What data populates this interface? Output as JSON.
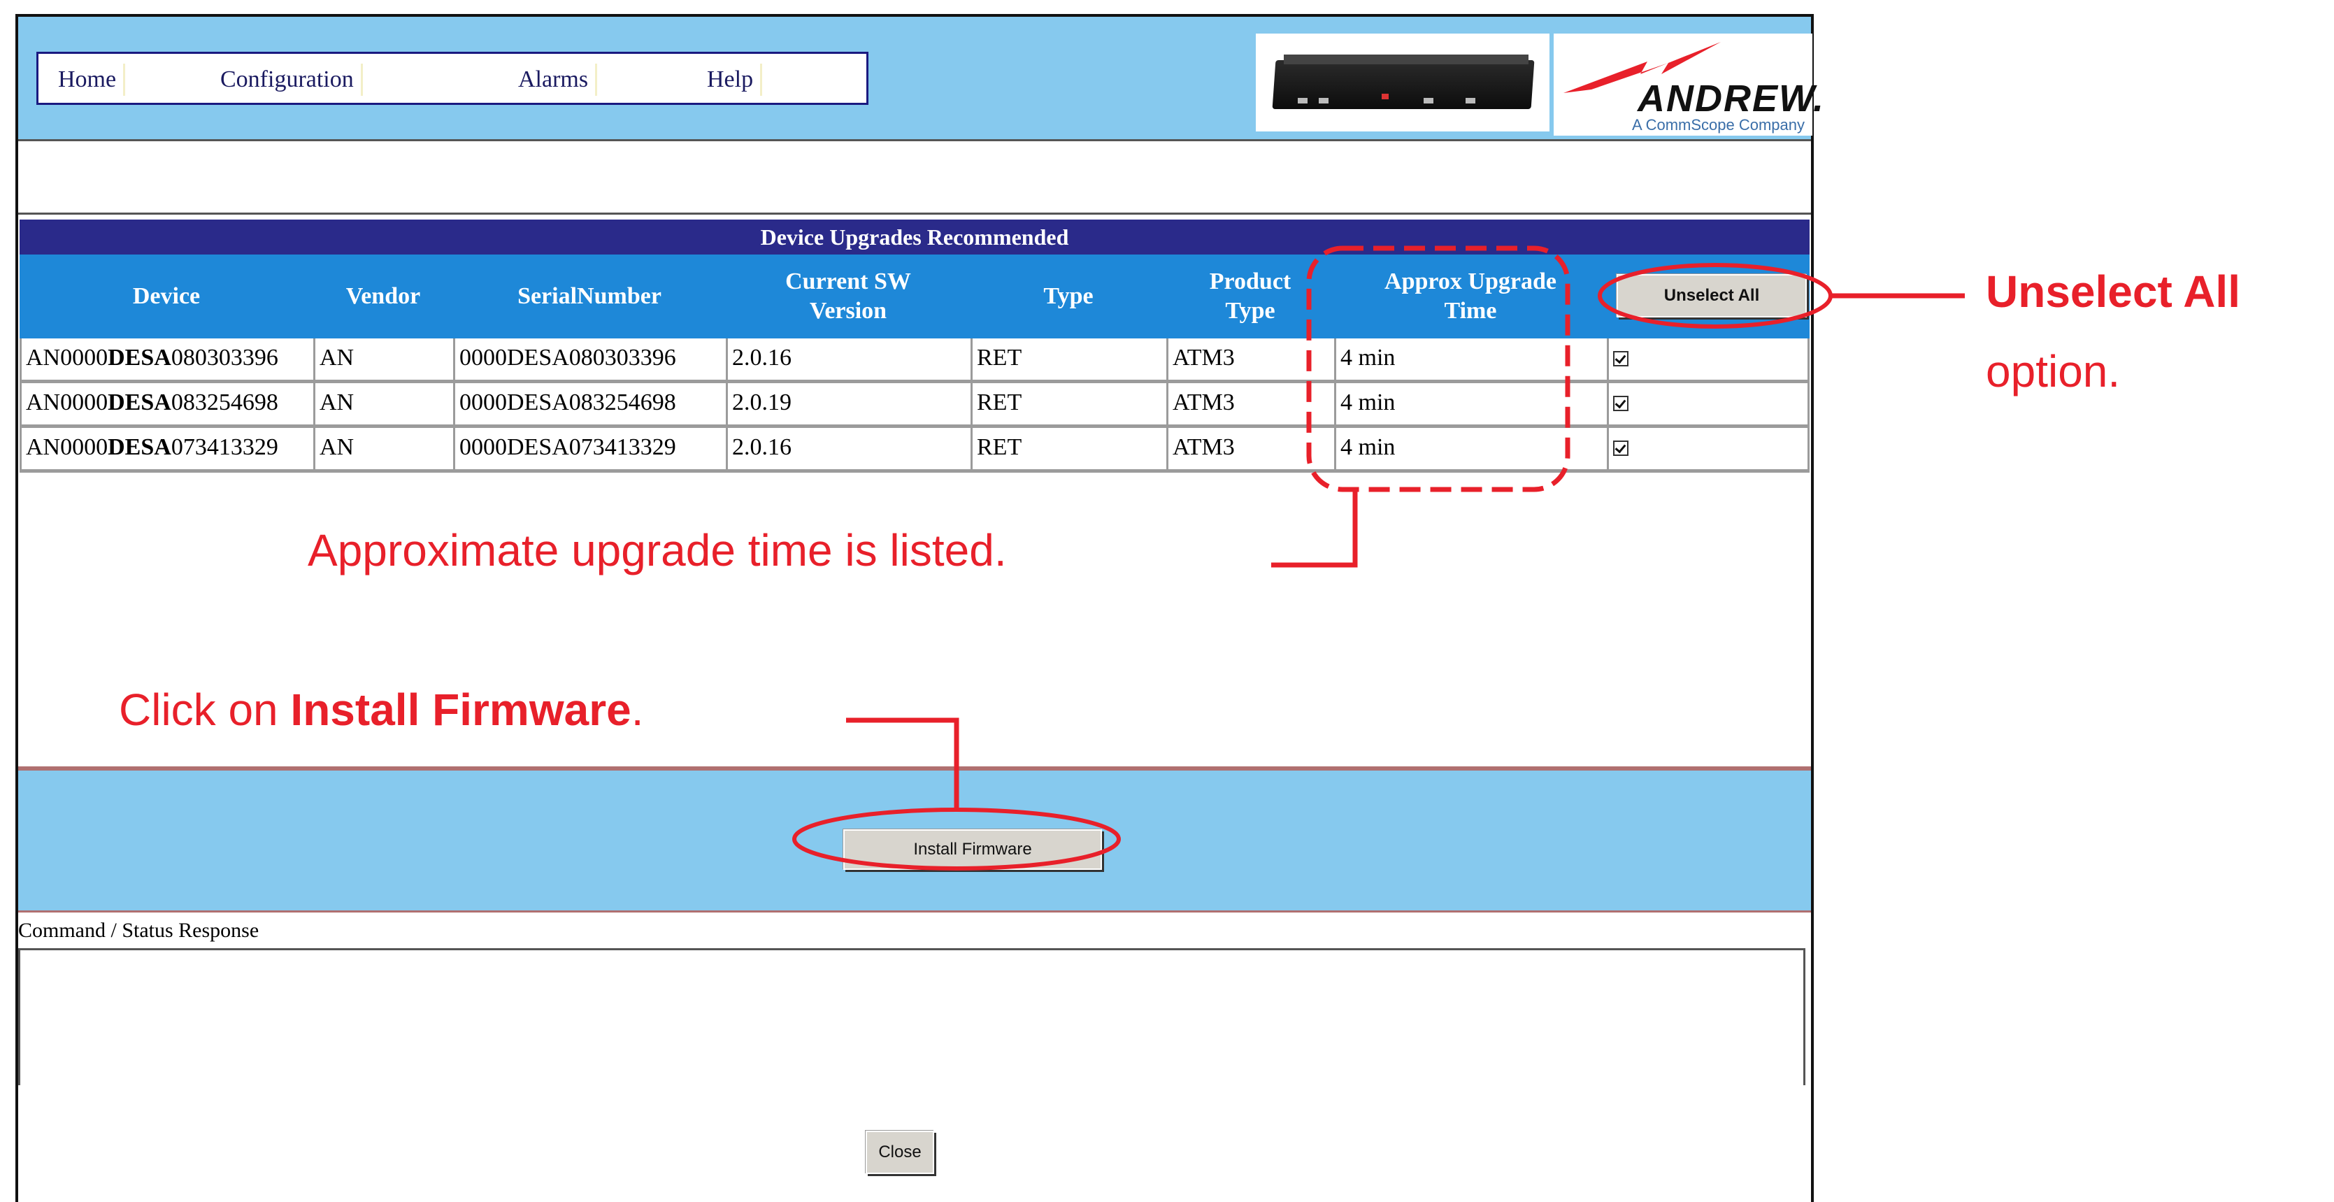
{
  "menu": {
    "items": [
      "Home",
      "Configuration",
      "Alarms",
      "Help"
    ]
  },
  "logo": {
    "name": "ANDREW.",
    "subtitle": "A CommScope Company"
  },
  "table": {
    "title": "Device Upgrades Recommended",
    "headers": {
      "device": "Device",
      "vendor": "Vendor",
      "serial": "SerialNumber",
      "sw1": "Current SW",
      "sw2": "Version",
      "type": "Type",
      "ptype1": "Product",
      "ptype2": "Type",
      "time1": "Approx Upgrade",
      "time2": "Time"
    },
    "unselect_label": "Unselect All",
    "rows": [
      {
        "device_a": "AN0000",
        "device_b": "DESA",
        "device_c": "080303396",
        "vendor": "AN",
        "serial": "0000DESA080303396",
        "sw": "2.0.16",
        "type": "RET",
        "ptype": "ATM3",
        "time": "4 min",
        "checked": true
      },
      {
        "device_a": "AN0000",
        "device_b": "DESA",
        "device_c": "083254698",
        "vendor": "AN",
        "serial": "0000DESA083254698",
        "sw": "2.0.19",
        "type": "RET",
        "ptype": "ATM3",
        "time": "4 min",
        "checked": true
      },
      {
        "device_a": "AN0000",
        "device_b": "DESA",
        "device_c": "073413329",
        "vendor": "AN",
        "serial": "0000DESA073413329",
        "sw": "2.0.16",
        "type": "RET",
        "ptype": "ATM3",
        "time": "4 min",
        "checked": true
      }
    ]
  },
  "install_label": "Install Firmware",
  "status_label": "Command / Status Response",
  "close_label": "Close",
  "annotations": {
    "unselect_1": "Unselect All",
    "unselect_2": "option.",
    "approx": "Approximate upgrade time is listed.",
    "click_pre": "Click on ",
    "click_bold": "Install Firmware",
    "click_post": "."
  },
  "colors": {
    "header_band": "#86c9ee",
    "table_title": "#2a2a8a",
    "table_head": "#1e88d8",
    "annotation": "#e8202a"
  }
}
